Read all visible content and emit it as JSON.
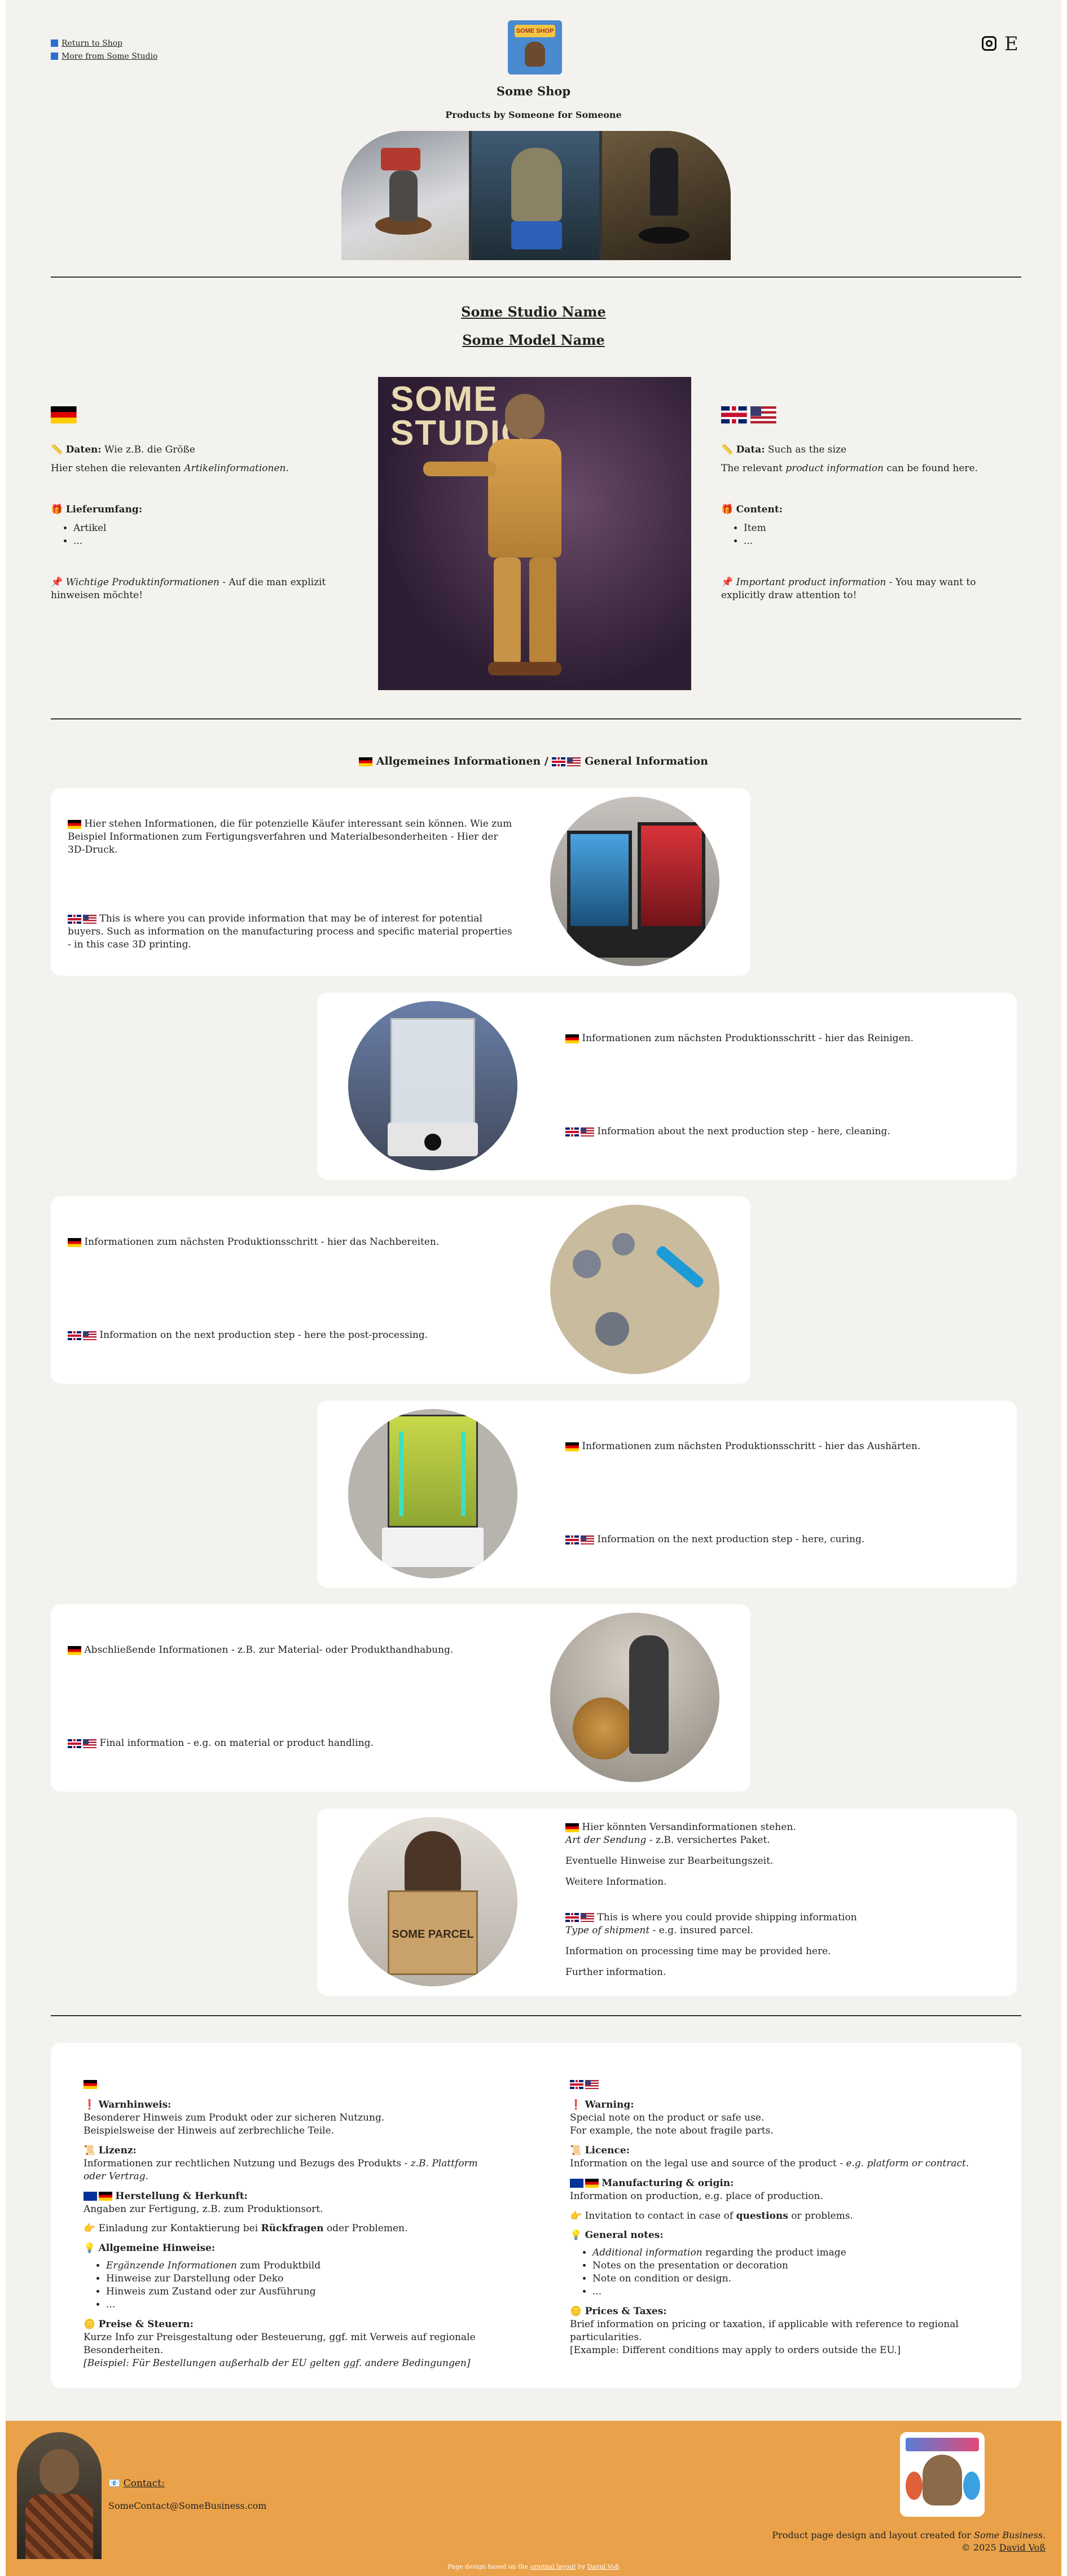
{
  "header": {
    "return_link": "Return to Shop",
    "more_link": "More from Some Studio",
    "logo_text": "SOME SHOP",
    "shop_name": "Some Shop",
    "tagline": "Products by Someone for Someone",
    "etsy_icon_label": "E"
  },
  "product": {
    "studio_name": "Some Studio Name",
    "model_name": "Some Model Name",
    "hero_text_line1": "SOME",
    "hero_text_line2": "STUDIO",
    "de": {
      "data_label": "Daten:",
      "data_value": "Wie z.B. die Größe",
      "data_desc_pre": "Hier stehen die relevanten ",
      "data_desc_em": "Artikelinformationen",
      "data_desc_post": ".",
      "content_label": "Lieferumfang:",
      "items": [
        "Artikel",
        "..."
      ],
      "important_em": "Wichtige Produktinformationen",
      "important_rest": " - Auf die man explizit hinweisen möchte!"
    },
    "en": {
      "data_label": "Data:",
      "data_value": "Such as the size",
      "data_desc_pre": "The relevant ",
      "data_desc_em": "product information",
      "data_desc_post": " can be found here.",
      "content_label": "Content:",
      "items": [
        "Item",
        "..."
      ],
      "important_em": "Important product information",
      "important_rest": " - You may want to explicitly draw attention to!"
    }
  },
  "general": {
    "heading_de": "Allgemeines Informationen /",
    "heading_en": "General Information",
    "steps": [
      {
        "de": "Hier stehen Informationen, die für potenzielle Käufer interessant sein können. Wie zum Beispiel Informationen zum Fertigungsverfahren und Materialbesonderheiten - Hier der 3D-Druck.",
        "en": "This is where you can provide information that may be of interest for potential buyers. Such as information on the manufacturing process and specific material properties - in this case 3D printing.",
        "img": "SOME PRINTER"
      },
      {
        "de": "Informationen zum nächsten Produktionsschritt - hier das Reinigen.",
        "en": "Information about the next production step - here, cleaning.",
        "img": "Some Washing Station"
      },
      {
        "de": "Informationen zum nächsten Produktionsschritt - hier das Nachbereiten.",
        "en": "Information on the next production step - here the post-processing.",
        "img": ""
      },
      {
        "de": "Informationen zum nächsten Produktionsschritt - hier das Aushärten.",
        "en": "Information on the next production step - here, curing.",
        "img": "SOME CURING STATION"
      },
      {
        "de": "Abschließende Informationen - z.B. zur Material- oder Produkthandhabung.",
        "en": "Final information - e.g. on material or product handling.",
        "img": ""
      }
    ],
    "shipping": {
      "de_line1": "Hier könnten Versandinformationen stehen.",
      "de_line2_em": "Art der Sendung",
      "de_line2_rest": " - z.B. versichertes Paket.",
      "de_line3": "Eventuelle Hinweise zur Bearbeitungszeit.",
      "de_line4": "Weitere Information.",
      "en_line1": "This is where you could provide shipping information",
      "en_line2_em": "Type of shipment",
      "en_line2_rest": " - e.g. insured parcel.",
      "en_line3": "Information on processing time may be provided here.",
      "en_line4": "Further information.",
      "img": "SOME PARCEL"
    }
  },
  "notes": {
    "de": {
      "warning_label": "Warnhinweis:",
      "warning_text": "Besonderer Hinweis zum Produkt oder zur sicheren Nutzung.",
      "warning_text2": "Beispielsweise der Hinweis auf zerbrechliche Teile.",
      "licence_label": "Lizenz:",
      "licence_text": "Informationen zur rechtlichen Nutzung und Bezugs des Produkts - ",
      "licence_em": "z.B. Plattform oder Vertrag",
      "licence_end": ".",
      "origin_label": "Herstellung & Herkunft:",
      "origin_text": "Angaben zur Fertigung, z.B. zum Produktionsort.",
      "contact_pre": "Einladung zur Kontaktierung bei ",
      "contact_bold": "Rückfragen",
      "contact_post": " oder Problemen.",
      "general_label": "Allgemeine Hinweise:",
      "general_items": [
        {
          "em": "Ergänzende Informationen",
          "rest": " zum Produktbild"
        },
        {
          "em": "",
          "rest": "Hinweise zur Darstellung oder Deko"
        },
        {
          "em": "",
          "rest": "Hinweis zum Zustand oder zur Ausführung"
        },
        {
          "em": "",
          "rest": "..."
        }
      ],
      "prices_label": "Preise & Steuern:",
      "prices_text": "Kurze Info zur Preisgestaltung oder Besteuerung, ggf. mit Verweis auf regionale Besonderheiten.",
      "prices_example": "[Beispiel: Für Bestellungen außerhalb der EU gelten ggf. andere Bedingungen]"
    },
    "en": {
      "warning_label": "Warning:",
      "warning_text": "Special note on the product or safe use.",
      "warning_text2": "For example, the note about fragile parts.",
      "licence_label": "Licence:",
      "licence_text": "Information on the legal use and source of the product - ",
      "licence_em": "e.g. platform or contract",
      "licence_end": ".",
      "origin_label": "Manufacturing & origin:",
      "origin_text": "Information on production, e.g. place of production.",
      "contact_pre": "Invitation to contact in case of ",
      "contact_bold": "questions",
      "contact_post": " or problems.",
      "general_label": "General notes:",
      "general_items": [
        {
          "em": "Additional information",
          "rest": " regarding the product image"
        },
        {
          "em": "",
          "rest": "Notes on the presentation or decoration"
        },
        {
          "em": "",
          "rest": "Note on condition or design."
        },
        {
          "em": "",
          "rest": "..."
        }
      ],
      "prices_label": "Prices & Taxes:",
      "prices_text": "Brief information on pricing or taxation, if applicable with reference to regional particularities.",
      "prices_example": "[Example: Different conditions may apply to orders outside the EU.]"
    }
  },
  "footer": {
    "contact_label": "Contact:",
    "contact_email": "SomeContact@SomeBusiness.com",
    "credit_pre": "Product page design and layout created for ",
    "credit_em": "Some Business",
    "credit_post": ".",
    "copyright_pre": "© 2025 ",
    "copyright_name": "David Voß",
    "bottom_pre": "Page design based on the ",
    "bottom_link": "original layout",
    "bottom_mid": " by ",
    "bottom_name": "David Voß",
    "colors": {
      "footer_bg": "#e9a14a",
      "page_bg": "#f3f2ee"
    }
  }
}
